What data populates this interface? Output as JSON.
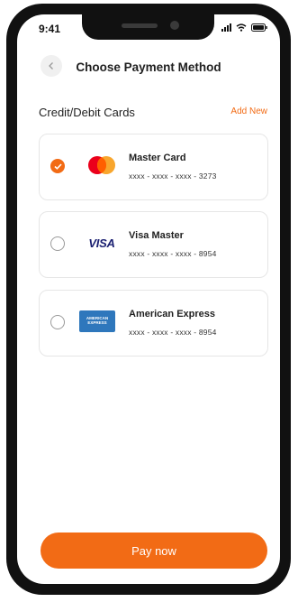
{
  "status_bar": {
    "time": "9:41"
  },
  "header": {
    "title": "Choose Payment Method"
  },
  "section": {
    "title": "Credit/Debit Cards",
    "add_new": "Add New"
  },
  "cards": [
    {
      "name": "Master Card",
      "number": "xxxx - xxxx - xxxx - 3273",
      "selected": true,
      "logo": "mastercard-logo"
    },
    {
      "name": "Visa Master",
      "number": "xxxx - xxxx - xxxx - 8954",
      "selected": false,
      "logo": "visa-logo",
      "logo_text": "VISA"
    },
    {
      "name": "American Express",
      "number": "xxxx - xxxx - xxxx - 8954",
      "selected": false,
      "logo": "amex-logo",
      "logo_text": "AMERICAN EXPRESS"
    }
  ],
  "footer": {
    "pay_label": "Pay now"
  },
  "colors": {
    "accent": "#f26b15",
    "border": "#e6e6e6",
    "mastercard_red": "#eb001b",
    "mastercard_yellow": "#f79e1b",
    "visa_blue": "#1a1f71",
    "amex_blue": "#2e77bc"
  }
}
